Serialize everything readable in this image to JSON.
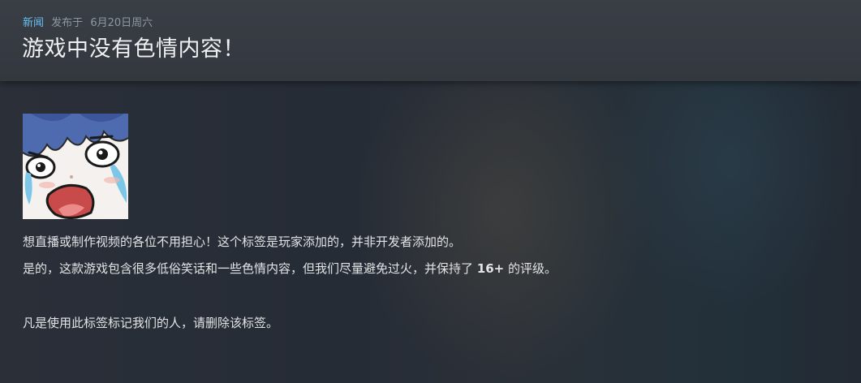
{
  "header": {
    "tag": "新闻",
    "published_prefix": "发布于",
    "date": "6月20日周六",
    "title": "游戏中没有色情内容！"
  },
  "emote": {
    "icon": "shocked-crying-face-emoticon"
  },
  "body": {
    "line1": "想直播或制作视频的各位不用担心！这个标签是玩家添加的，并非开发者添加的。",
    "line2_before": "是的，这款游戏包含很多低俗笑话和一些色情内容，但我们尽量避免过火，并保持了",
    "line2_rating": "16+",
    "line2_after": "的评级。",
    "line3": "凡是使用此标签标记我们的人，请删除该标签。"
  },
  "colors": {
    "tag": "#66c0f4",
    "meta": "#8f98a0",
    "title": "#eef0f2",
    "body_text": "#e2e4e6"
  }
}
